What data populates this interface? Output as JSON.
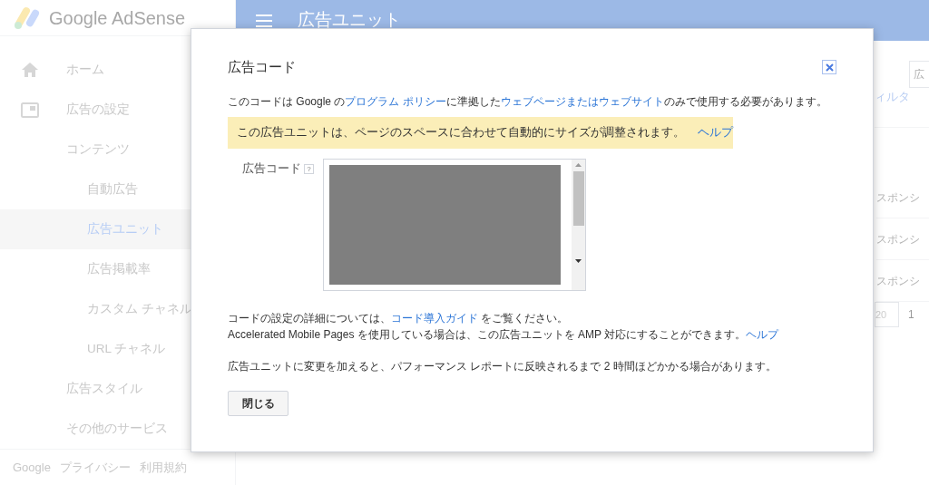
{
  "app": {
    "logo_text": "Google AdSense"
  },
  "sidebar": {
    "items": [
      {
        "label": "ホーム",
        "kind": "home",
        "selected": false
      },
      {
        "label": "広告の設定",
        "kind": "ad",
        "selected": false
      },
      {
        "label": "コンテンツ",
        "selected": false,
        "children": [
          {
            "label": "自動広告",
            "selected": false
          },
          {
            "label": "広告ユニット",
            "selected": true
          },
          {
            "label": "広告掲載率",
            "selected": false
          },
          {
            "label": "カスタム チャネル",
            "selected": false
          },
          {
            "label": "URL チャネル",
            "selected": false
          }
        ]
      },
      {
        "label": "広告スタイル",
        "selected": false
      },
      {
        "label": "その他のサービス",
        "selected": false
      }
    ],
    "footer": [
      "Google",
      "プライバシー",
      "利用規約"
    ]
  },
  "header": {
    "title": "広告ユニット"
  },
  "background": {
    "search_placeholder": "広",
    "filter_link": "ィルタ",
    "rows": [
      "スポンシ",
      "スポンシ",
      "スポンシ"
    ],
    "page_size": "20",
    "page": "1"
  },
  "dialog": {
    "title": "広告コード",
    "notice": [
      {
        "kind": "text",
        "text": "このコードは Google の"
      },
      {
        "kind": "link",
        "text": "プログラム ポリシー"
      },
      {
        "kind": "text",
        "text": "に準拠した"
      },
      {
        "kind": "link",
        "text": "ウェブページまたはウェブサイト"
      },
      {
        "kind": "text",
        "text": "のみで使用する必要があります。"
      }
    ],
    "banner": {
      "text": "この広告ユニットは、ページのスペースに合わせて自動的にサイズが調整されます。",
      "link": "ヘルプ"
    },
    "code_label": "広告コード",
    "help_mark": "?",
    "guide": [
      {
        "kind": "text",
        "text": "コードの設定の詳細については、"
      },
      {
        "kind": "link",
        "text": "コード導入ガイド"
      },
      {
        "kind": "text",
        "text": " をご覧ください。"
      }
    ],
    "amp": [
      {
        "kind": "text",
        "text": "Accelerated Mobile Pages を使用している場合は、この広告ユニットを AMP 対応にすることができます。"
      },
      {
        "kind": "link",
        "text": "ヘルプ"
      }
    ],
    "note": "広告ユニットに変更を加えると、パフォーマンス レポートに反映されるまで 2 時間ほどかかる場合があります。",
    "close_button": "閉じる"
  }
}
